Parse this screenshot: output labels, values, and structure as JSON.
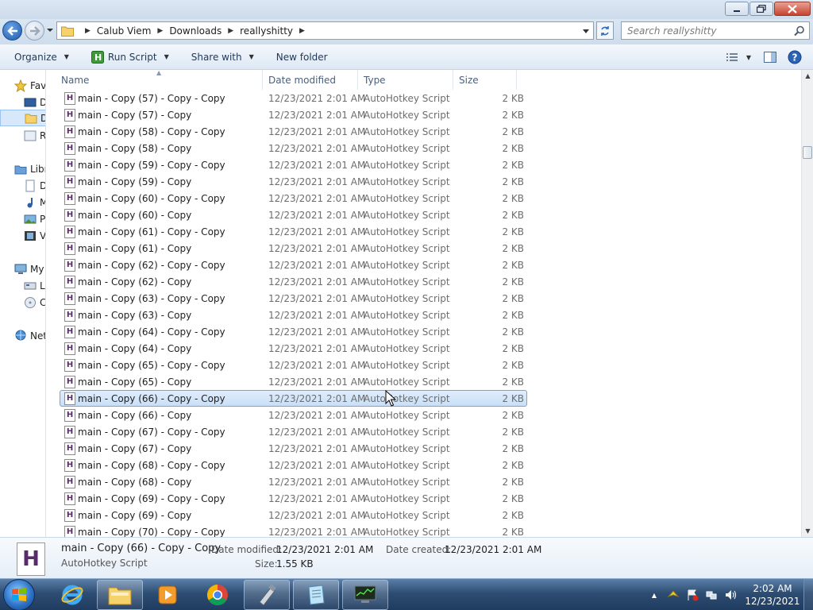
{
  "nav": {
    "breadcrumb": [
      "Calub Viem",
      "Downloads",
      "reallyshitty"
    ],
    "search_placeholder": "Search reallyshitty"
  },
  "commands": {
    "organize": "Organize",
    "run_script": "Run Script",
    "share_with": "Share with",
    "new_folder": "New folder"
  },
  "navpane": {
    "favorites": "Fav",
    "desktop": "D",
    "downloads": "D",
    "recent": "R",
    "libraries": "Libr",
    "documents": "D",
    "music": "M",
    "pictures": "P",
    "videos": "V",
    "mycomputer": "My",
    "localdisk": "L",
    "dvd": "C",
    "network": "Net"
  },
  "columns": {
    "name": "Name",
    "date": "Date modified",
    "type": "Type",
    "size": "Size"
  },
  "files": [
    {
      "name": "main - Copy (57) - Copy - Copy",
      "date": "12/23/2021 2:01 AM",
      "type": "AutoHotkey Script",
      "size": "2 KB"
    },
    {
      "name": "main - Copy (57) - Copy",
      "date": "12/23/2021 2:01 AM",
      "type": "AutoHotkey Script",
      "size": "2 KB"
    },
    {
      "name": "main - Copy (58) - Copy - Copy",
      "date": "12/23/2021 2:01 AM",
      "type": "AutoHotkey Script",
      "size": "2 KB"
    },
    {
      "name": "main - Copy (58) - Copy",
      "date": "12/23/2021 2:01 AM",
      "type": "AutoHotkey Script",
      "size": "2 KB"
    },
    {
      "name": "main - Copy (59) - Copy - Copy",
      "date": "12/23/2021 2:01 AM",
      "type": "AutoHotkey Script",
      "size": "2 KB"
    },
    {
      "name": "main - Copy (59) - Copy",
      "date": "12/23/2021 2:01 AM",
      "type": "AutoHotkey Script",
      "size": "2 KB"
    },
    {
      "name": "main - Copy (60) - Copy - Copy",
      "date": "12/23/2021 2:01 AM",
      "type": "AutoHotkey Script",
      "size": "2 KB"
    },
    {
      "name": "main - Copy (60) - Copy",
      "date": "12/23/2021 2:01 AM",
      "type": "AutoHotkey Script",
      "size": "2 KB"
    },
    {
      "name": "main - Copy (61) - Copy - Copy",
      "date": "12/23/2021 2:01 AM",
      "type": "AutoHotkey Script",
      "size": "2 KB"
    },
    {
      "name": "main - Copy (61) - Copy",
      "date": "12/23/2021 2:01 AM",
      "type": "AutoHotkey Script",
      "size": "2 KB"
    },
    {
      "name": "main - Copy (62) - Copy - Copy",
      "date": "12/23/2021 2:01 AM",
      "type": "AutoHotkey Script",
      "size": "2 KB"
    },
    {
      "name": "main - Copy (62) - Copy",
      "date": "12/23/2021 2:01 AM",
      "type": "AutoHotkey Script",
      "size": "2 KB"
    },
    {
      "name": "main - Copy (63) - Copy - Copy",
      "date": "12/23/2021 2:01 AM",
      "type": "AutoHotkey Script",
      "size": "2 KB"
    },
    {
      "name": "main - Copy (63) - Copy",
      "date": "12/23/2021 2:01 AM",
      "type": "AutoHotkey Script",
      "size": "2 KB"
    },
    {
      "name": "main - Copy (64) - Copy - Copy",
      "date": "12/23/2021 2:01 AM",
      "type": "AutoHotkey Script",
      "size": "2 KB"
    },
    {
      "name": "main - Copy (64) - Copy",
      "date": "12/23/2021 2:01 AM",
      "type": "AutoHotkey Script",
      "size": "2 KB"
    },
    {
      "name": "main - Copy (65) - Copy - Copy",
      "date": "12/23/2021 2:01 AM",
      "type": "AutoHotkey Script",
      "size": "2 KB"
    },
    {
      "name": "main - Copy (65) - Copy",
      "date": "12/23/2021 2:01 AM",
      "type": "AutoHotkey Script",
      "size": "2 KB"
    },
    {
      "name": "main - Copy (66) - Copy - Copy",
      "date": "12/23/2021 2:01 AM",
      "type": "AutoHotkey Script",
      "size": "2 KB",
      "selected": true
    },
    {
      "name": "main - Copy (66) - Copy",
      "date": "12/23/2021 2:01 AM",
      "type": "AutoHotkey Script",
      "size": "2 KB"
    },
    {
      "name": "main - Copy (67) - Copy - Copy",
      "date": "12/23/2021 2:01 AM",
      "type": "AutoHotkey Script",
      "size": "2 KB"
    },
    {
      "name": "main - Copy (67) - Copy",
      "date": "12/23/2021 2:01 AM",
      "type": "AutoHotkey Script",
      "size": "2 KB"
    },
    {
      "name": "main - Copy (68) - Copy - Copy",
      "date": "12/23/2021 2:01 AM",
      "type": "AutoHotkey Script",
      "size": "2 KB"
    },
    {
      "name": "main - Copy (68) - Copy",
      "date": "12/23/2021 2:01 AM",
      "type": "AutoHotkey Script",
      "size": "2 KB"
    },
    {
      "name": "main - Copy (69) - Copy - Copy",
      "date": "12/23/2021 2:01 AM",
      "type": "AutoHotkey Script",
      "size": "2 KB"
    },
    {
      "name": "main - Copy (69) - Copy",
      "date": "12/23/2021 2:01 AM",
      "type": "AutoHotkey Script",
      "size": "2 KB"
    },
    {
      "name": "main - Copy (70) - Copy - Copy",
      "date": "12/23/2021 2:01 AM",
      "type": "AutoHotkey Script",
      "size": "2 KB"
    }
  ],
  "details": {
    "name": "main - Copy (66) - Copy - Copy",
    "type": "AutoHotkey Script",
    "date_modified_label": "Date modified:",
    "date_modified": "12/23/2021 2:01 AM",
    "date_created_label": "Date created:",
    "date_created": "12/23/2021 2:01 AM",
    "size_label": "Size:",
    "size": "1.55 KB",
    "icon_letter": "H"
  },
  "taskbar": {
    "time": "2:02 AM",
    "date": "12/23/2021"
  },
  "colors": {
    "selection": "#cce4f7",
    "accent": "#1e395b"
  }
}
